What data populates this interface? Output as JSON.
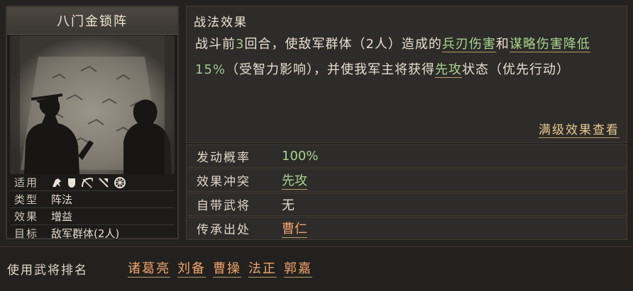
{
  "tactic": {
    "name": "八门金锁阵",
    "labels": {
      "applies": "适用",
      "type": "类型",
      "effect": "效果",
      "target": "目标"
    },
    "type": "阵法",
    "effect": "增益",
    "target": "敌军群体(2人)",
    "unit_icons": [
      "cavalry-icon",
      "shield-infantry-icon",
      "archer-icon",
      "spear-icon",
      "chariot-icon"
    ]
  },
  "effect_panel": {
    "title": "战法效果",
    "parts": {
      "p1": "战斗前",
      "rounds": "3",
      "p2": "回合，使敌军群体（2人）造成的",
      "k1": "兵刃伤害",
      "p3": "和",
      "k2": "谋略伤害降低",
      "pct": "15%",
      "p4": "（受智力影响），并使我军主将获得",
      "k3": "先攻",
      "p5": "状态（优先行动）"
    },
    "full_link": "满级效果查看"
  },
  "stats": {
    "trigger_label": "发动概率",
    "trigger_value": "100%",
    "conflict_label": "效果冲突",
    "conflict_value": "先攻",
    "general_label": "自带武将",
    "general_value": "无",
    "inherit_label": "传承出处",
    "inherit_value": "曹仁"
  },
  "ranking": {
    "label": "使用武将排名",
    "names": [
      "诸葛亮",
      "刘备",
      "曹操",
      "法正",
      "郭嘉"
    ]
  },
  "colors": {
    "accent_green": "#a6d58c",
    "accent_orange": "#f0a468",
    "panel": "#2e2c2a"
  }
}
